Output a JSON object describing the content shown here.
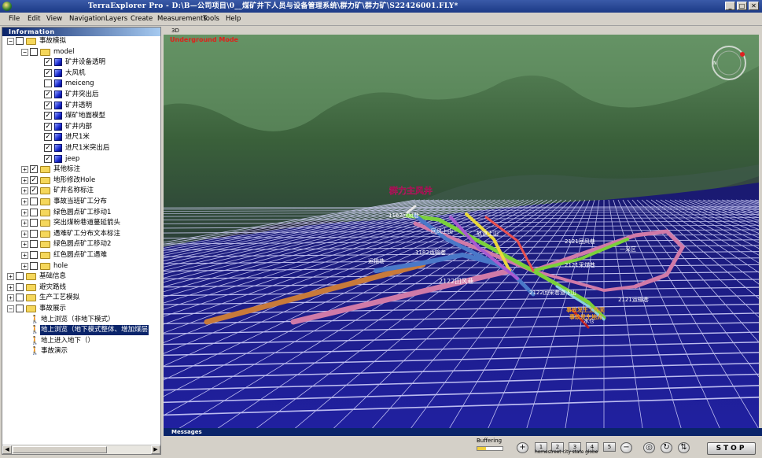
{
  "window": {
    "title": "TerraExplorer Pro - D:\\B—公司项目\\0__煤矿井下人员与设备管理系统\\群力矿\\群力矿\\S22426001.FLY*",
    "minimize": "_",
    "maximize": "□",
    "close": "✕"
  },
  "menu": [
    "File",
    "Edit",
    "View",
    "Navigation",
    "Layers",
    "Create",
    "Measurements",
    "Tools",
    "Help"
  ],
  "panel": {
    "title": "Information",
    "tree": [
      {
        "label": "事故模拟",
        "level": 0,
        "expander": "−",
        "check": "",
        "icon": "folder"
      },
      {
        "label": "model",
        "level": 1,
        "expander": "−",
        "check": "",
        "icon": "folder"
      },
      {
        "label": "矿井设备透明",
        "level": 2,
        "expander": "",
        "check": "✓",
        "icon": "cube"
      },
      {
        "label": "大风机",
        "level": 2,
        "expander": "",
        "check": "✓",
        "icon": "cube"
      },
      {
        "label": "meiceng",
        "level": 2,
        "expander": "",
        "check": "",
        "icon": "cube"
      },
      {
        "label": "矿井突出后",
        "level": 2,
        "expander": "",
        "check": "✓",
        "icon": "cube"
      },
      {
        "label": "矿井透明",
        "level": 2,
        "expander": "",
        "check": "✓",
        "icon": "cube"
      },
      {
        "label": "煤矿地面模型",
        "level": 2,
        "expander": "",
        "check": "✓",
        "icon": "cube"
      },
      {
        "label": "矿井内部",
        "level": 2,
        "expander": "",
        "check": "✓",
        "icon": "cube"
      },
      {
        "label": "进尺1米",
        "level": 2,
        "expander": "",
        "check": "✓",
        "icon": "cube"
      },
      {
        "label": "进尺1米突出后",
        "level": 2,
        "expander": "",
        "check": "✓",
        "icon": "cube"
      },
      {
        "label": "jeep",
        "level": 2,
        "expander": "",
        "check": "✓",
        "icon": "cube"
      },
      {
        "label": "其他标注",
        "level": 1,
        "expander": "+",
        "check": "✓",
        "icon": "folder"
      },
      {
        "label": "地形修改Hole",
        "level": 1,
        "expander": "+",
        "check": "✓",
        "icon": "folder"
      },
      {
        "label": "矿井名称标注",
        "level": 1,
        "expander": "+",
        "check": "✓",
        "icon": "folder"
      },
      {
        "label": "事故当班矿工分布",
        "level": 1,
        "expander": "+",
        "check": "",
        "icon": "folder"
      },
      {
        "label": "绿色圆点矿工移动1",
        "level": 1,
        "expander": "+",
        "check": "",
        "icon": "folder"
      },
      {
        "label": "突出煤粉巷道蔓延箭头",
        "level": 1,
        "expander": "+",
        "check": "",
        "icon": "folder"
      },
      {
        "label": "遇难矿工分布文本标注",
        "level": 1,
        "expander": "+",
        "check": "",
        "icon": "folder"
      },
      {
        "label": "绿色圆点矿工移动2",
        "level": 1,
        "expander": "+",
        "check": "",
        "icon": "folder"
      },
      {
        "label": "红色圆点矿工遇难",
        "level": 1,
        "expander": "+",
        "check": "",
        "icon": "folder"
      },
      {
        "label": "hole",
        "level": 1,
        "expander": "+",
        "check": "",
        "icon": "folder"
      },
      {
        "label": "基础信息",
        "level": 0,
        "expander": "+",
        "check": "",
        "icon": "folder"
      },
      {
        "label": "避灾路线",
        "level": 0,
        "expander": "+",
        "check": "",
        "icon": "folder"
      },
      {
        "label": "生产工艺模拟",
        "level": 0,
        "expander": "+",
        "check": "",
        "icon": "folder"
      },
      {
        "label": "事故展示",
        "level": 0,
        "expander": "−",
        "check": "",
        "icon": "folder"
      },
      {
        "label": "地上浏览（非地下模式）",
        "level": 1,
        "expander": "",
        "check": "",
        "icon": "walk"
      },
      {
        "label": "地上浏览（地下模式整体、增加煤层",
        "level": 1,
        "expander": "",
        "check": "",
        "icon": "walk",
        "selected": true
      },
      {
        "label": "地上进入地下（）",
        "level": 1,
        "expander": "",
        "check": "",
        "icon": "walk"
      },
      {
        "label": "事故演示",
        "level": 1,
        "expander": "",
        "check": "",
        "icon": "walk"
      }
    ]
  },
  "view": {
    "tab": "3D",
    "mode": "Underground Mode",
    "compass_letter": "N",
    "labels": {
      "shaft": "群力主风井",
      "l1162": "1162回风巷",
      "l1182": "1182运输巷",
      "l2122": "2122回风巷",
      "l2122b": "2122回采巷道下山",
      "l2121": "2121回风巷",
      "l2121b": "2121运输巷",
      "l2121c": "2121采煤巷",
      "ramp1": "回风上山",
      "ramp2": "轨道上山",
      "accident1": "事故发生工作面",
      "accident2": "事故发生地点",
      "misc1": "运输巷",
      "misc2": "一采区",
      "misc3": "水仓"
    },
    "colors": {
      "terrain_dark": "#2e4a2e",
      "terrain_light": "#5e8a5e",
      "water": "#1c1c8c",
      "grid": "#c8c8ff",
      "tunnel_orange": "#c87a3a",
      "tunnel_pink": "#d07aa8",
      "tunnel_green": "#7ad03a",
      "tunnel_blue": "#4a78c8",
      "tunnel_yellow": "#e8d83a",
      "tunnel_purple": "#a85ad0"
    }
  },
  "messages_label": "Messages",
  "bottom": {
    "buffering": "Buffering",
    "buffer_level": 0.35,
    "zoom_in": "+",
    "zoom_out": "−",
    "quick": [
      "1",
      "2",
      "3",
      "4",
      "5"
    ],
    "quick_labels": "homestreet city state globe",
    "stop": "STOP"
  }
}
